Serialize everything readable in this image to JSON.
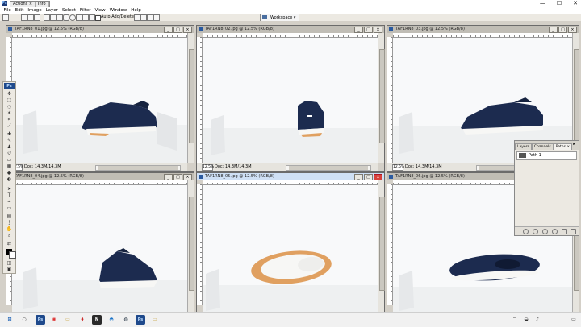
{
  "window": {
    "app_badge": "Ps",
    "floating_tabs": [
      "Actions ×",
      "Info"
    ],
    "controls": {
      "minimize": "—",
      "maximize": "☐",
      "close": "✕"
    }
  },
  "menu": [
    "File",
    "Edit",
    "Image",
    "Layer",
    "Select",
    "Filter",
    "View",
    "Window",
    "Help"
  ],
  "options_bar": {
    "auto_add_delete_label": "Auto Add/Delete",
    "workspace_label": "Workspace ▾"
  },
  "tools_palette": {
    "badge": "Ps"
  },
  "documents": [
    {
      "title": "TAF1RN8_01.jpg @ 12.5% (RGB/8)",
      "zoom": "12.5%",
      "doc_info": "Doc: 14.3M/14.3M",
      "active": false
    },
    {
      "title": "TAF1RN8_02.jpg @ 12.5% (RGB/8)",
      "zoom": "12.5%",
      "doc_info": "Doc: 14.3M/14.3M",
      "active": false
    },
    {
      "title": "TAF1RN8_03.jpg @ 12.5% (RGB/8)",
      "zoom": "12.5%",
      "doc_info": "Doc: 14.3M/14.3M",
      "active": false
    },
    {
      "title": "TAF1RN8_04.jpg @ 12.5% (RGB/8)",
      "zoom": "12.5%",
      "doc_info": "Doc: 14.3M/14.3M",
      "active": false
    },
    {
      "title": "TAF1RN8_05.jpg @ 12.5% (RGB/8)",
      "zoom": "12.5%",
      "doc_info": "Doc: 14.3M/14.3M",
      "active": true
    },
    {
      "title": "TAF1RN8_06.jpg @ 12.5% (RGB/8)",
      "zoom": "12.5%",
      "doc_info": "Doc: 14.3M/14.3M",
      "active": false
    }
  ],
  "panel": {
    "tabs": [
      "Layers",
      "Channels",
      "Paths ×"
    ],
    "selected_tab": "Paths ×",
    "path_item": "Path 1"
  },
  "taskbar": {
    "time": "",
    "date": ""
  },
  "colors": {
    "shoe_navy": "#1c2b4f",
    "sole_orange": "#e0a060",
    "sole_white": "#f7f7f5",
    "ps_blue": "#1f4a8c"
  }
}
